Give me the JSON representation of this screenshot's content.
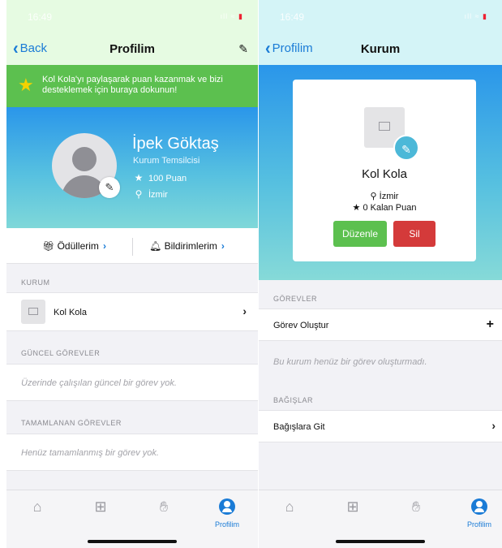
{
  "left": {
    "status": {
      "time": "16:49",
      "signal": "ıll ≈"
    },
    "nav": {
      "back_label": "Back",
      "title": "Profilim"
    },
    "banner": {
      "text": "Kol Kola'yı paylaşarak puan kazanmak ve bizi desteklemek için buraya dokunun!"
    },
    "profile": {
      "name": "İpek Göktaş",
      "role": "Kurum Temsilcisi",
      "points": "100 Puan",
      "city": "İzmir"
    },
    "tabs": {
      "rewards": "Ödüllerim",
      "notifications": "Bildirimlerim"
    },
    "org_section": {
      "header": "KURUM",
      "org_name": "Kol Kola"
    },
    "current_tasks": {
      "header": "GÜNCEL GÖREVLER",
      "empty": "Üzerinde çalışılan güncel bir görev yok."
    },
    "completed_tasks": {
      "header": "TAMAMLANAN GÖREVLER",
      "empty": "Henüz tamamlanmış bir görev yok."
    },
    "tabbar": {
      "profile_label": "Profilim"
    }
  },
  "right": {
    "status": {
      "time": "16:49",
      "signal": "ıll ≈"
    },
    "nav": {
      "back_label": "Profilim",
      "title": "Kurum"
    },
    "org": {
      "name": "Kol Kola",
      "city": "İzmir",
      "points": "0 Kalan Puan",
      "edit_label": "Düzenle",
      "delete_label": "Sil"
    },
    "tasks": {
      "header": "GÖREVLER",
      "create_label": "Görev Oluştur",
      "empty": "Bu kurum henüz bir görev oluşturmadı."
    },
    "donations": {
      "header": "BAĞIŞLAR",
      "link_label": "Bağışlara Git"
    },
    "tabbar": {
      "profile_label": "Profilim"
    }
  },
  "colors": {
    "accent": "#1a7bd6",
    "banner_green": "#5cc04f",
    "delete_red": "#d43a3a",
    "edit_green": "#5cc04f"
  },
  "icons": [
    "pencil-icon",
    "star-icon",
    "location-pin-icon",
    "gift-icon",
    "bell-icon",
    "chevron-right-icon",
    "image-placeholder-icon",
    "home-icon",
    "hand-icon",
    "profile-icon",
    "plus-icon"
  ]
}
